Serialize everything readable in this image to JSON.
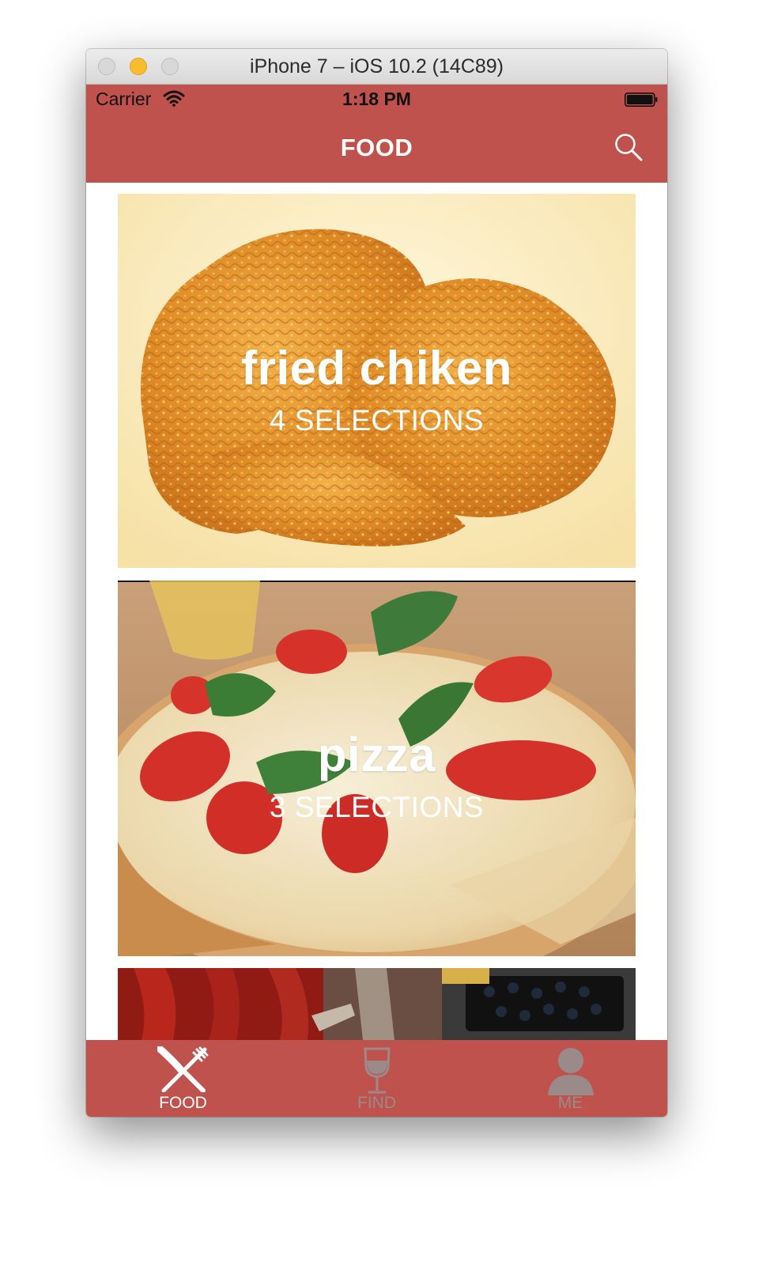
{
  "window": {
    "title": "iPhone 7 – iOS 10.2 (14C89)"
  },
  "status_bar": {
    "carrier": "Carrier",
    "time": "1:18 PM",
    "icons": [
      "wifi-icon",
      "battery-icon"
    ]
  },
  "nav": {
    "title": "FOOD",
    "search_icon": "search-icon"
  },
  "cards": [
    {
      "title": "fried chiken",
      "subtitle": "4 SELECTIONS",
      "image": "fried-chicken"
    },
    {
      "title": "pizza",
      "subtitle": "3 SELECTIONS",
      "image": "pizza"
    },
    {
      "title": "",
      "subtitle": "",
      "image": "partial-dish"
    }
  ],
  "tabs": [
    {
      "label": "FOOD",
      "icon": "fork-knife-icon",
      "active": true
    },
    {
      "label": "FIND",
      "icon": "wine-glass-icon",
      "active": false
    },
    {
      "label": "ME",
      "icon": "person-icon",
      "active": false
    }
  ],
  "colors": {
    "accent": "#c0524d",
    "tab_active": "#ffffff",
    "tab_inactive": "#9a8a8a"
  }
}
